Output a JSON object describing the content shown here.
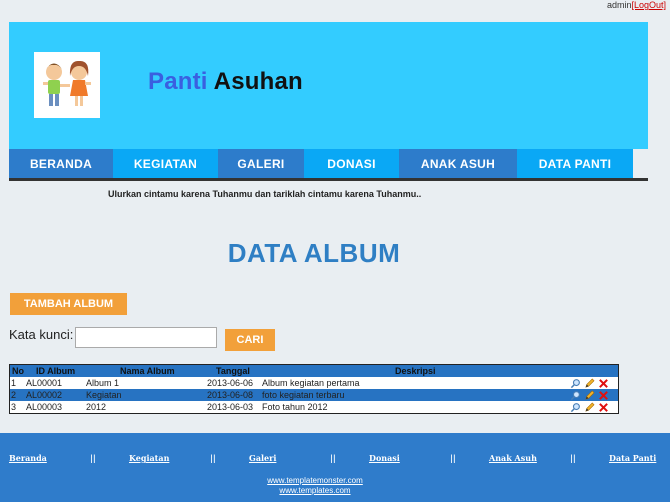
{
  "user": {
    "name": "admin",
    "logout_label": "[LogOut]"
  },
  "site": {
    "title_part1": "Panti",
    "title_part2": "Asuhan"
  },
  "nav": {
    "items": [
      {
        "label": "BERANDA"
      },
      {
        "label": "KEGIATAN"
      },
      {
        "label": "GALERI"
      },
      {
        "label": "DONASI"
      },
      {
        "label": "ANAK ASUH"
      },
      {
        "label": "DATA PANTI"
      }
    ]
  },
  "tagline": "Ulurkan cintamu karena Tuhanmu dan tariklah cintamu karena Tuhanmu..",
  "page": {
    "title": "DATA ALBUM"
  },
  "buttons": {
    "add_album": "TAMBAH ALBUM",
    "search": "CARI"
  },
  "search": {
    "label": "Kata kunci:",
    "value": "",
    "placeholder": ""
  },
  "table": {
    "headers": {
      "no": "No",
      "id": "ID Album",
      "name": "Nama Album",
      "date": "Tanggal",
      "desc": "Deskripsi"
    },
    "rows": [
      {
        "no": "1",
        "id": "AL00001",
        "name": "Album 1",
        "date": "2013-06-06",
        "desc": "Album kegiatan pertama"
      },
      {
        "no": "2",
        "id": "AL00002",
        "name": "Kegiatan",
        "date": "2013-06-08",
        "desc": "foto kegiatan terbaru"
      },
      {
        "no": "3",
        "id": "AL00003",
        "name": "2012",
        "date": "2013-06-03",
        "desc": "Foto tahun 2012"
      }
    ],
    "actions": [
      "view-icon",
      "edit-pencil-icon",
      "delete-x-icon"
    ]
  },
  "footer": {
    "nav": [
      {
        "label": "Beranda"
      },
      {
        "label": "Kegiatan"
      },
      {
        "label": "Galeri"
      },
      {
        "label": "Donasi"
      },
      {
        "label": "Anak Asuh"
      },
      {
        "label": "Data Panti"
      }
    ],
    "separator": "||",
    "urls": [
      "www.templatemonster.com",
      "www.templates.com"
    ]
  },
  "colors": {
    "header_bg": "#33ccff",
    "nav_dark": "#2d7ccb",
    "nav_light": "#0aa8f5",
    "accent_orange": "#f2a03a",
    "title_blue": "#2f7fc4",
    "footer_bg": "#2f7ccb"
  }
}
